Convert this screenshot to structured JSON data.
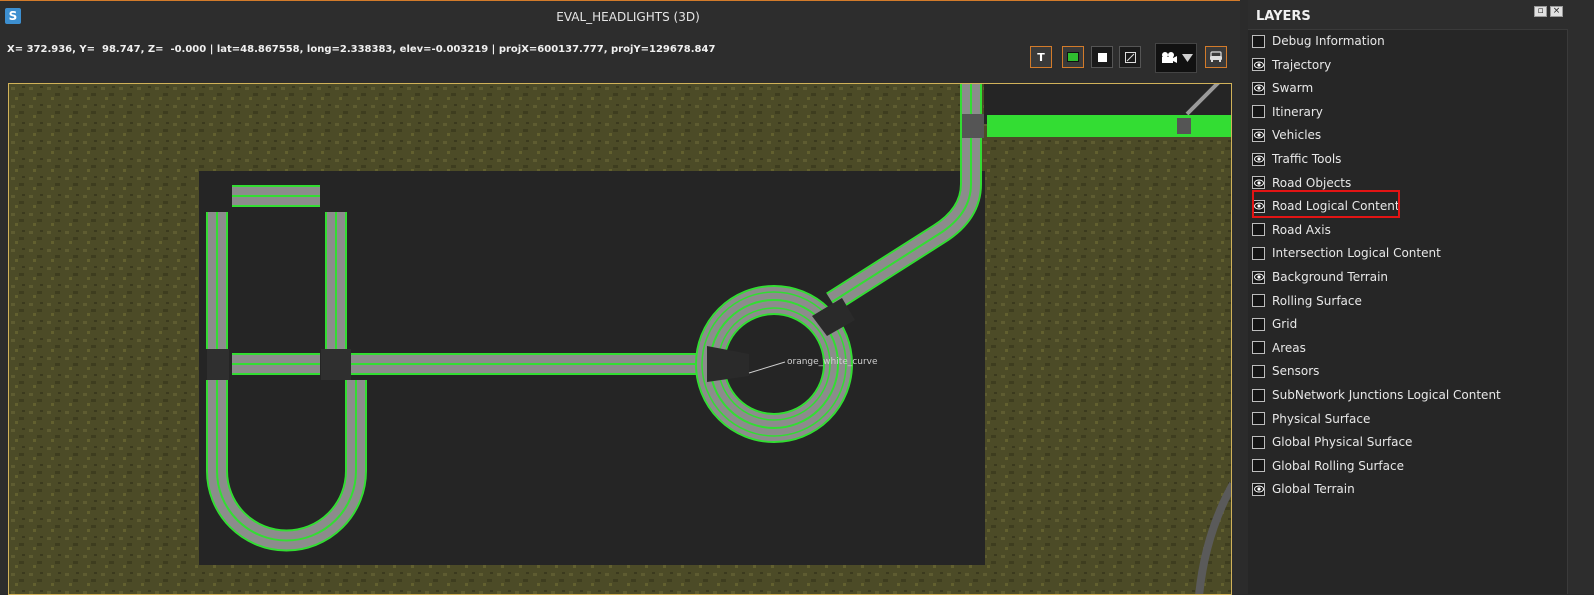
{
  "window": {
    "title": "EVAL_HEADLIGHTS (3D)",
    "logo_letter": "S"
  },
  "coords": {
    "text": "X= 372.936, Y=  98.747, Z=  -0.000 | lat=48.867558, long=2.338383, elev=-0.003219 | projX=600137.777, projY=129678.847"
  },
  "toolbar": {
    "text_tool_label": "T"
  },
  "scene": {
    "road_label": "orange_white_curve"
  },
  "colors": {
    "accent": "#d37b2a",
    "road_edge": "#33dd33",
    "highlight": "#e31414"
  },
  "layers_panel": {
    "title": "LAYERS",
    "items": [
      {
        "label": "Debug Information",
        "checked": false
      },
      {
        "label": "Trajectory",
        "checked": true
      },
      {
        "label": "Swarm",
        "checked": true
      },
      {
        "label": "Itinerary",
        "checked": false
      },
      {
        "label": "Vehicles",
        "checked": true
      },
      {
        "label": "Traffic Tools",
        "checked": true
      },
      {
        "label": "Road Objects",
        "checked": true
      },
      {
        "label": "Road Logical Content",
        "checked": true
      },
      {
        "label": "Road Axis",
        "checked": false
      },
      {
        "label": "Intersection Logical Content",
        "checked": false
      },
      {
        "label": "Background Terrain",
        "checked": true
      },
      {
        "label": "Rolling Surface",
        "checked": false
      },
      {
        "label": "Grid",
        "checked": false
      },
      {
        "label": "Areas",
        "checked": false
      },
      {
        "label": "Sensors",
        "checked": false
      },
      {
        "label": "SubNetwork Junctions Logical Content",
        "checked": false
      },
      {
        "label": "Physical Surface",
        "checked": false
      },
      {
        "label": "Global Physical Surface",
        "checked": false
      },
      {
        "label": "Global Rolling Surface",
        "checked": false
      },
      {
        "label": "Global Terrain",
        "checked": true
      }
    ]
  }
}
